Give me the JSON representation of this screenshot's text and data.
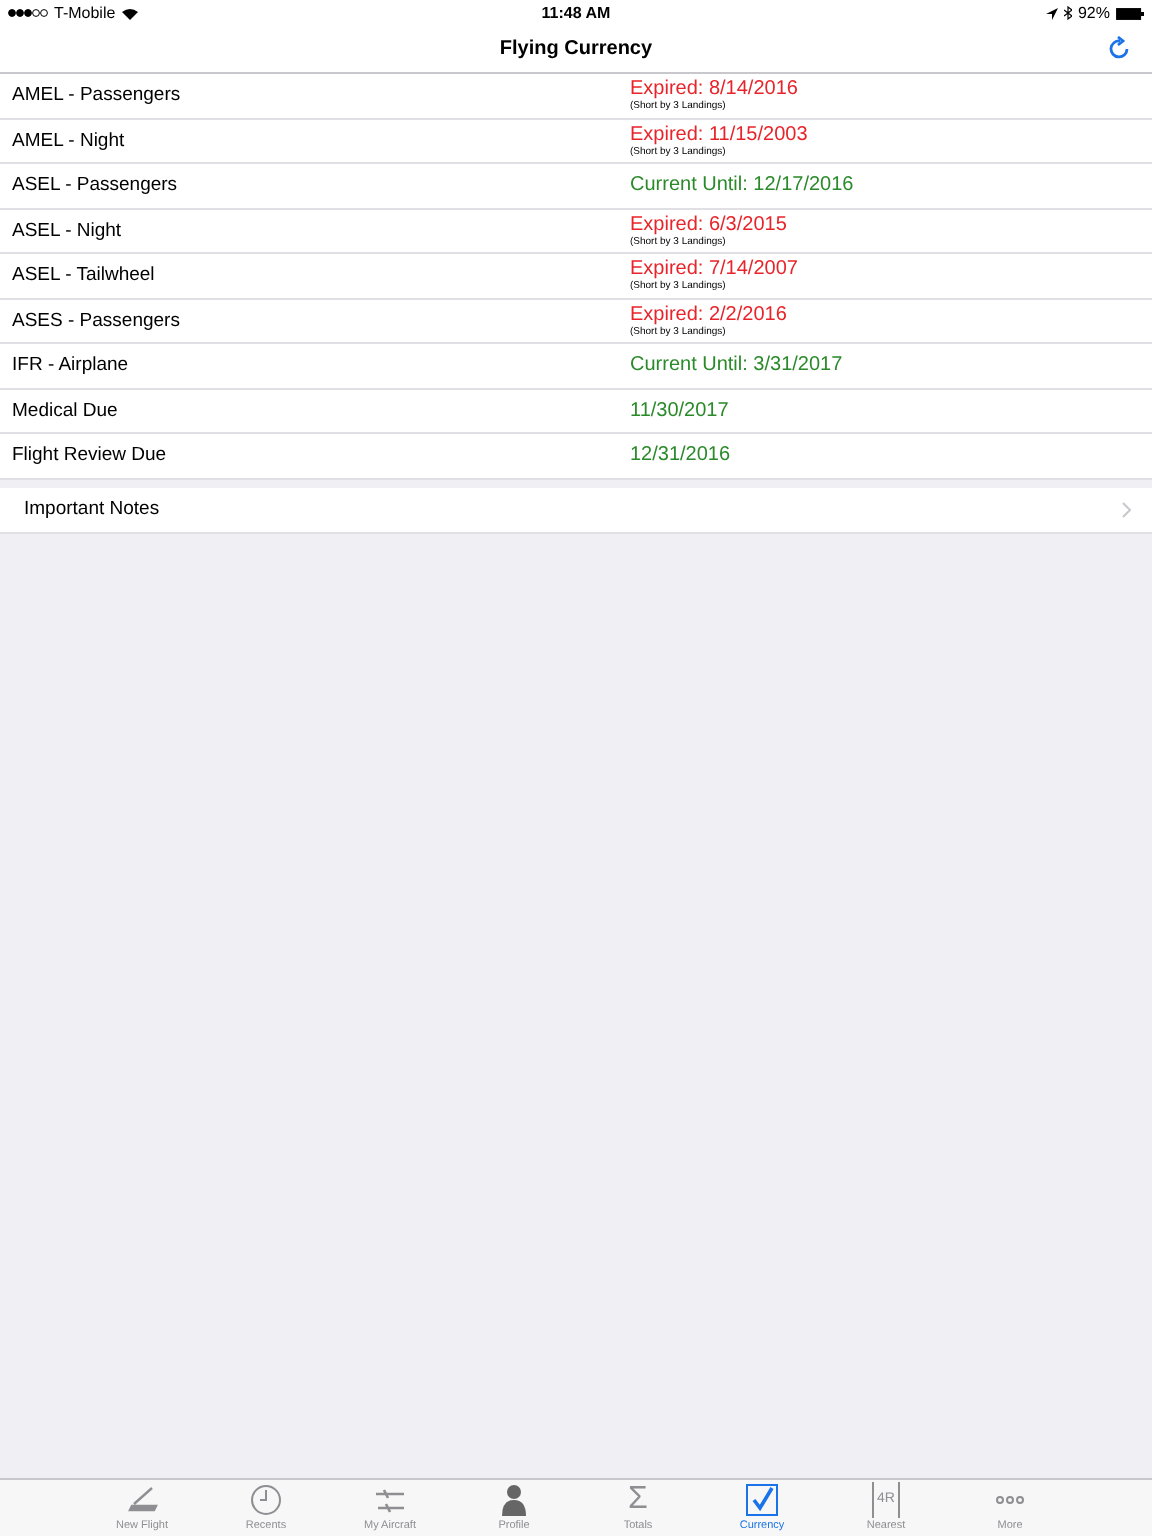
{
  "status_bar": {
    "carrier": "T-Mobile",
    "time": "11:48 AM",
    "battery": "92%"
  },
  "title": "Flying Currency",
  "rows": [
    {
      "label": "AMEL - Passengers",
      "kind": "expired",
      "value": "Expired: 8/14/2016",
      "note": "(Short by 3 Landings)"
    },
    {
      "label": "AMEL - Night",
      "kind": "expired",
      "value": "Expired: 11/15/2003",
      "note": "(Short by 3 Landings)"
    },
    {
      "label": "ASEL - Passengers",
      "kind": "current",
      "value": "Current Until: 12/17/2016"
    },
    {
      "label": "ASEL - Night",
      "kind": "expired",
      "value": "Expired: 6/3/2015",
      "note": "(Short by 3 Landings)"
    },
    {
      "label": "ASEL - Tailwheel",
      "kind": "expired",
      "value": "Expired: 7/14/2007",
      "note": "(Short by 3 Landings)"
    },
    {
      "label": "ASES - Passengers",
      "kind": "expired",
      "value": "Expired: 2/2/2016",
      "note": "(Short by 3 Landings)"
    },
    {
      "label": "IFR - Airplane",
      "kind": "current",
      "value": "Current Until: 3/31/2017"
    },
    {
      "label": "Medical Due",
      "kind": "current",
      "value": "11/30/2017"
    },
    {
      "label": "Flight Review Due",
      "kind": "current",
      "value": "12/31/2016"
    }
  ],
  "notes": {
    "label": "Important Notes"
  },
  "tabs": [
    {
      "label": "New Flight",
      "kind": "logbook",
      "selected": false
    },
    {
      "label": "Recents",
      "kind": "clock",
      "selected": false
    },
    {
      "label": "My Aircraft",
      "kind": "planes",
      "selected": false
    },
    {
      "label": "Profile",
      "kind": "person",
      "selected": false
    },
    {
      "label": "Totals",
      "kind": "glyph",
      "glyph": "Σ",
      "selected": false
    },
    {
      "label": "Currency",
      "kind": "check",
      "selected": true
    },
    {
      "label": "Nearest",
      "kind": "runway",
      "glyph": "4R",
      "selected": false
    },
    {
      "label": "More",
      "kind": "dots",
      "selected": false
    }
  ]
}
